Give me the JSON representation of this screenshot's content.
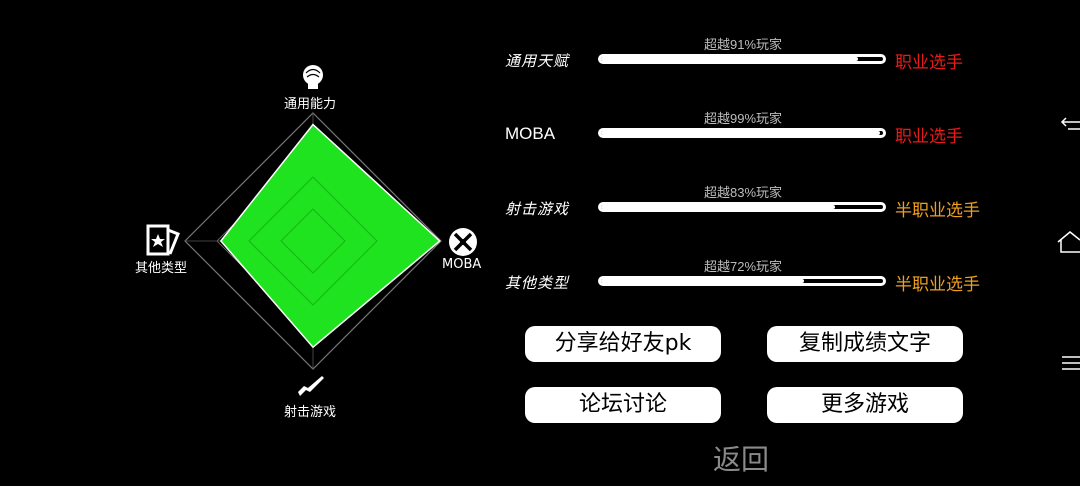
{
  "radar": {
    "labels": {
      "top": "通用能力",
      "right": "MOBA",
      "bottom": "射击游戏",
      "left": "其他类型"
    },
    "values": {
      "top": 0.91,
      "right": 0.99,
      "bottom": 0.83,
      "left": 0.72
    },
    "fill_color": "#1fe31f",
    "icons": {
      "top": "head-icon",
      "right": "moba-swords-icon",
      "bottom": "gun-icon",
      "left": "card-icon"
    }
  },
  "rows": [
    {
      "name": "通用天赋",
      "percent_text": "超越91%玩家",
      "value": 0.91,
      "rank": "职业选手",
      "rank_color": "#e81b1b"
    },
    {
      "name": "MOBA",
      "percent_text": "超越99%玩家",
      "value": 0.99,
      "rank": "职业选手",
      "rank_color": "#e81b1b"
    },
    {
      "name": "射击游戏",
      "percent_text": "超越83%玩家",
      "value": 0.83,
      "rank": "半职业选手",
      "rank_color": "#f0a020"
    },
    {
      "name": "其他类型",
      "percent_text": "超越72%玩家",
      "value": 0.72,
      "rank": "半职业选手",
      "rank_color": "#f0a020"
    }
  ],
  "buttons": {
    "share": "分享给好友pk",
    "copy": "复制成绩文字",
    "forum": "论坛讨论",
    "more": "更多游戏",
    "back": "返回"
  }
}
